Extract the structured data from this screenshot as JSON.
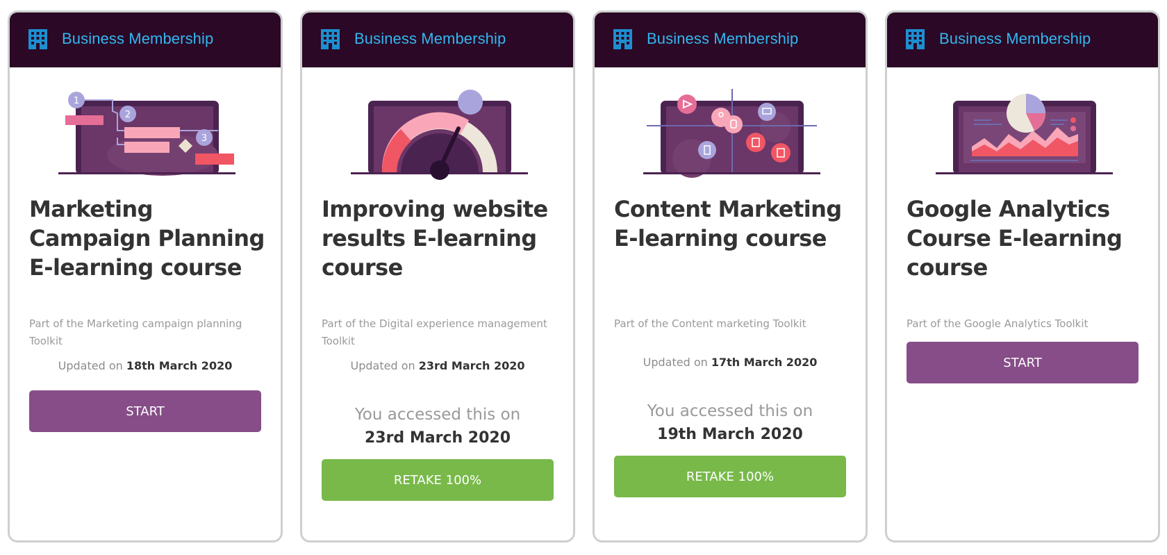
{
  "membership_label": "Business Membership",
  "updated_prefix": "Updated on",
  "accessed_prefix": "You accessed this on",
  "colors": {
    "header_bg": "#2a0826",
    "header_text": "#33b7ef",
    "start_button": "#864d88",
    "retake_button": "#78b94a"
  },
  "courses": [
    {
      "title": "Marketing Campaign Planning E-learning course",
      "subtitle": "Part of the Marketing campaign planning Toolkit",
      "updated_date": "18th March 2020",
      "accessed_date": null,
      "button_label": "START",
      "illustration": "campaign-planning-illustration"
    },
    {
      "title": "Improving website results E-learning course",
      "subtitle": "Part of the Digital experience management Toolkit",
      "updated_date": "23rd March 2020",
      "accessed_date": "23rd March 2020",
      "button_label": "RETAKE 100%",
      "illustration": "gauge-illustration"
    },
    {
      "title": "Content Marketing E-learning course",
      "subtitle": "Part of the Content marketing Toolkit",
      "updated_date": "17th March 2020",
      "accessed_date": "19th March 2020",
      "button_label": "RETAKE 100%",
      "illustration": "content-icons-illustration"
    },
    {
      "title": "Google Analytics Course E-learning course",
      "subtitle": "Part of the Google Analytics Toolkit",
      "updated_date": null,
      "accessed_date": null,
      "button_label": "START",
      "illustration": "analytics-chart-illustration"
    }
  ]
}
